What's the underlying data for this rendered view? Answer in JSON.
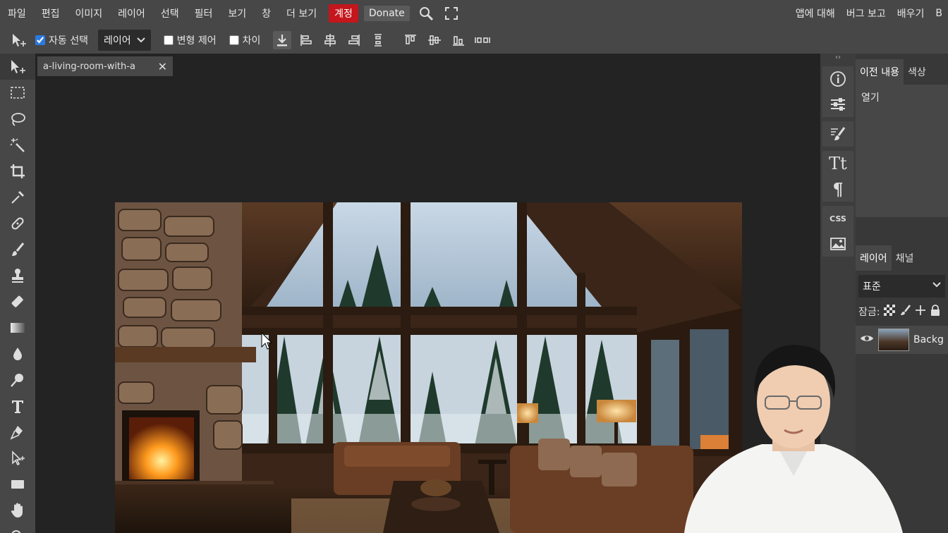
{
  "menu": {
    "items": [
      "파일",
      "편집",
      "이미지",
      "레이어",
      "선택",
      "필터",
      "보기",
      "창",
      "더 보기"
    ],
    "account": "계정",
    "donate": "Donate",
    "right_items": [
      "앱에 대해",
      "버그 보고",
      "배우기",
      "B"
    ]
  },
  "options": {
    "auto_select_label": "자동 선택",
    "auto_select_checked": true,
    "select_value": "레이어",
    "transform_label": "변형 제어",
    "diff_label": "차이"
  },
  "document": {
    "tab_title": "a-living-room-with-a",
    "close_glyph": "✕"
  },
  "panels": {
    "top_tabs": [
      "이전 내용",
      "색상"
    ],
    "history_items": [
      "열기"
    ],
    "layer_tabs": [
      "레이어",
      "채널"
    ],
    "blend_mode": "표준",
    "lock_label": "잠금:",
    "layers": [
      {
        "name": "Backg"
      }
    ]
  },
  "colors": {
    "menubar": "#474747",
    "workspace": "#232323",
    "account_bg": "#c4161c",
    "accent": "#2a7ae2"
  }
}
